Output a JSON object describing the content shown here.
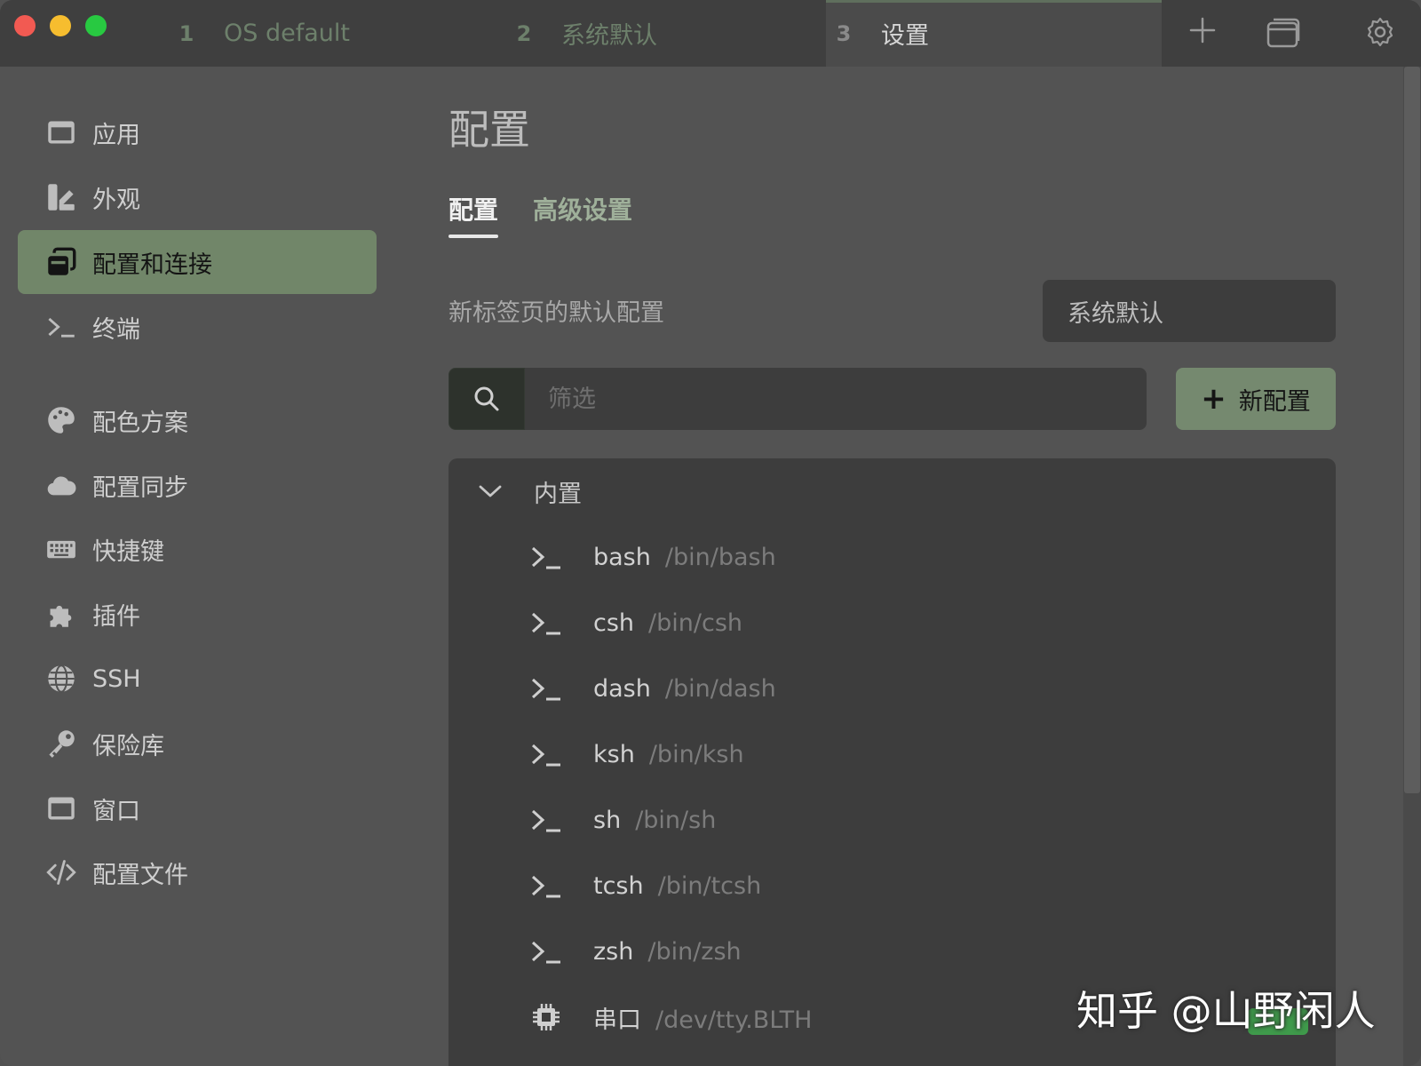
{
  "titlebar": {
    "tabs": [
      {
        "num": "1",
        "label": "OS default"
      },
      {
        "num": "2",
        "label": "系统默认"
      },
      {
        "num": "3",
        "label": "设置"
      }
    ],
    "icons": [
      "plus-icon",
      "window-icon",
      "gear-icon"
    ]
  },
  "sidebar": {
    "items": [
      {
        "label": "应用",
        "icon": "window-icon"
      },
      {
        "label": "外观",
        "icon": "appearance-icon"
      },
      {
        "label": "配置和连接",
        "icon": "profiles-icon",
        "active": true
      },
      {
        "label": "终端",
        "icon": "terminal-icon"
      },
      {
        "label": "配色方案",
        "icon": "palette-icon"
      },
      {
        "label": "配置同步",
        "icon": "cloud-icon"
      },
      {
        "label": "快捷键",
        "icon": "keyboard-icon"
      },
      {
        "label": "插件",
        "icon": "puzzle-icon"
      },
      {
        "label": "SSH",
        "icon": "globe-icon"
      },
      {
        "label": "保险库",
        "icon": "key-icon"
      },
      {
        "label": "窗口",
        "icon": "window-icon"
      },
      {
        "label": "配置文件",
        "icon": "code-icon"
      }
    ]
  },
  "main": {
    "title": "配置",
    "tabs": [
      "配置",
      "高级设置"
    ],
    "default_profile_label": "新标签页的默认配置",
    "default_profile_value": "系统默认",
    "filter_placeholder": "筛选",
    "new_profile_label": "新配置",
    "group_title": "内置",
    "profiles": [
      {
        "name": "bash",
        "path": "/bin/bash",
        "icon": "terminal-icon"
      },
      {
        "name": "csh",
        "path": "/bin/csh",
        "icon": "terminal-icon"
      },
      {
        "name": "dash",
        "path": "/bin/dash",
        "icon": "terminal-icon"
      },
      {
        "name": "ksh",
        "path": "/bin/ksh",
        "icon": "terminal-icon"
      },
      {
        "name": "sh",
        "path": "/bin/sh",
        "icon": "terminal-icon"
      },
      {
        "name": "tcsh",
        "path": "/bin/tcsh",
        "icon": "terminal-icon"
      },
      {
        "name": "zsh",
        "path": "/bin/zsh",
        "icon": "terminal-icon"
      },
      {
        "name": "串口",
        "path": "/dev/tty.BLTH",
        "icon": "chip-icon"
      }
    ]
  },
  "watermark": "知乎 @山野闲人",
  "colors": {
    "accent": "#718669",
    "button": "#75896f",
    "window_bg": "#535353",
    "titlebar_bg": "#3f3f3f",
    "panel_bg": "#3d3d3d"
  }
}
